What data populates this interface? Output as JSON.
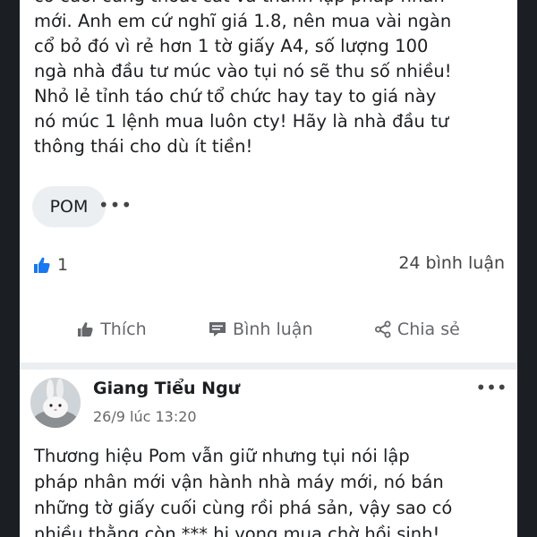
{
  "post1": {
    "lines": [
      "có cuối cùng thoát cát và thành lập pháp nhân",
      "mới. Anh em cứ nghĩ giá 1.8, nên mua vài ngàn",
      "cổ bỏ đó vì rẻ hơn 1 tờ giấy A4, số lượng 100",
      "ngà nhà đầu tư múc vào tụi nó sẽ thu số nhiều!",
      "Nhỏ lẻ tỉnh táo chứ tổ chức hay tay to giá này",
      "nó múc 1 lệnh mua luôn cty! Hãy là nhà đầu tư",
      "thông thái cho dù ít tiền!"
    ],
    "tag": "POM",
    "more": "•••",
    "like_count": "1",
    "comment_count": "24 bình luận",
    "actions": {
      "like": "Thích",
      "comment": "Bình luận",
      "share": "Chia sẻ"
    },
    "colors": {
      "like_badge": "#1877f2"
    }
  },
  "post2": {
    "author": "Giang Tiểu Ngư",
    "time": "26/9 lúc 13:20",
    "more": "•••",
    "lines": [
      "Thương hiệu Pom vẫn giữ nhưng tụi nói lập",
      "pháp nhân mới vận hành nhà máy mới, nó bán",
      "những tờ giấy cuối cùng rồi phá sản, vậy sao có",
      "nhiều thằng còn *** hi vọng mua chờ hồi sinh!"
    ]
  },
  "icons": {
    "like_badge": "thumbs-up-badge-icon",
    "like": "thumbs-up-icon",
    "comment": "comment-bubble-icon",
    "share": "share-icon",
    "more": "more-horizontal-icon"
  }
}
